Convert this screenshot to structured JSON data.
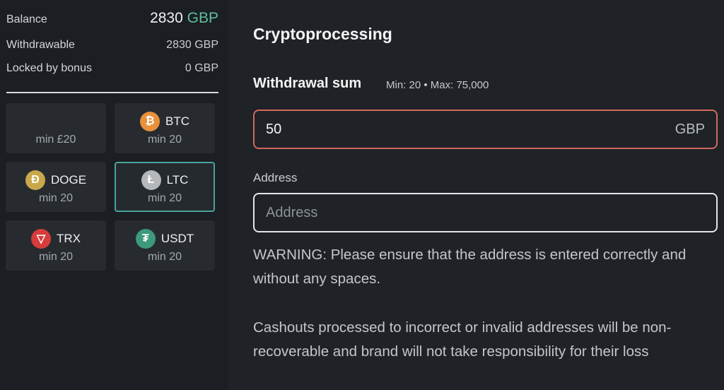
{
  "balance": {
    "label": "Balance",
    "amount": "2830",
    "currency": "GBP",
    "withdrawable_label": "Withdrawable",
    "withdrawable_value": "2830 GBP",
    "locked_label": "Locked by bonus",
    "locked_value": "0 GBP"
  },
  "methods": [
    {
      "name": "",
      "min": "min £20",
      "icon": "",
      "selected": false
    },
    {
      "name": "BTC",
      "min": "min 20",
      "icon": "bitcoin-icon",
      "glyph": "₿",
      "selected": false
    },
    {
      "name": "DOGE",
      "min": "min 20",
      "icon": "dogecoin-icon",
      "glyph": "Ð",
      "selected": false
    },
    {
      "name": "LTC",
      "min": "min 20",
      "icon": "litecoin-icon",
      "glyph": "Ł",
      "selected": true
    },
    {
      "name": "TRX",
      "min": "min 20",
      "icon": "tron-icon",
      "glyph": "▽",
      "selected": false
    },
    {
      "name": "USDT",
      "min": "min 20",
      "icon": "tether-icon",
      "glyph": "₮",
      "selected": false
    }
  ],
  "form": {
    "title": "Cryptoprocessing",
    "sum_label": "Withdrawal sum",
    "sum_range": "Min: 20 • Max: 75,000",
    "amount_value": "50",
    "amount_currency": "GBP",
    "address_label": "Address",
    "address_placeholder": "Address",
    "warning_1": "WARNING: Please ensure that the address is entered correctly and without any spaces.",
    "warning_2": "Cashouts processed to incorrect or invalid addresses will be non-recoverable and brand will not take responsibility for their loss"
  },
  "colors": {
    "accent": "#5fbf9f",
    "selected_border": "#4aa39b",
    "error_border": "#d06a5c"
  }
}
